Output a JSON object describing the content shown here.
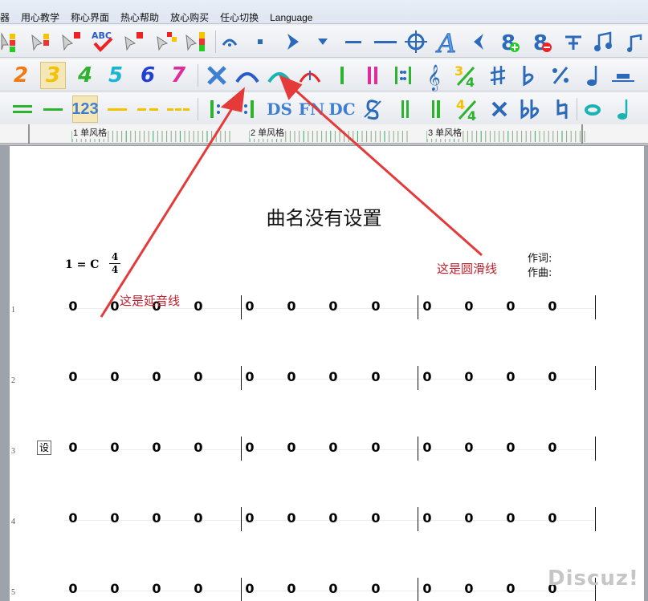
{
  "menu": [
    "器",
    "用心教学",
    "称心界面",
    "热心帮助",
    "放心购买",
    "任心切换",
    "Language"
  ],
  "toolbar2": {
    "digits": [
      "2",
      "3",
      "4",
      "5",
      "6",
      "7"
    ]
  },
  "toolbar3": {
    "number_mode_label": "123",
    "ds_label": "DS",
    "fin_label": "FN",
    "dc_label": "DC"
  },
  "ruler": {
    "labels": [
      "1 单风格",
      "2 单风格",
      "3 单风格"
    ]
  },
  "score": {
    "title": "曲名没有设置",
    "key": "1 = C",
    "time_top": "4",
    "time_bottom": "4",
    "lyricist_label": "作词:",
    "composer_label": "作曲:",
    "row_numbers": [
      "1",
      "2",
      "3",
      "4",
      "5"
    ],
    "note_value": "0",
    "side_marker": "设"
  },
  "annotations": {
    "tie_label": "这是延音线",
    "slur_label": "这是圆滑线"
  },
  "watermark": "Discuz!",
  "colors": {
    "arrow": "#e53a3a",
    "digit2": "#f07a10",
    "digit3": "#f2c200",
    "digit4": "#2db32d",
    "digit5": "#18b5d4",
    "digit6": "#1f3fd6",
    "digit7": "#e02c9a"
  }
}
